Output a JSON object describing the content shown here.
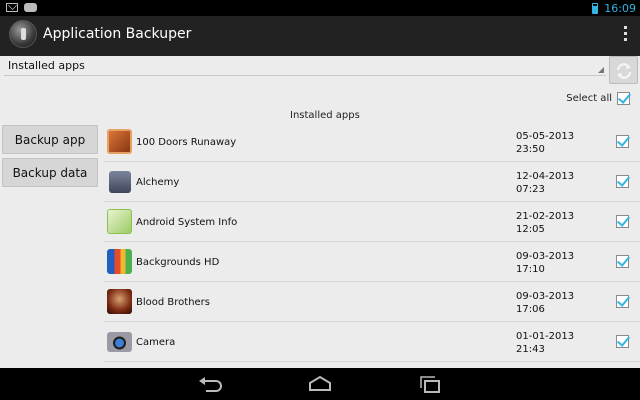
{
  "status_bar": {
    "time": "16:09"
  },
  "action_bar": {
    "title": "Application Backuper"
  },
  "spinner": {
    "selected": "Installed apps"
  },
  "select_all": {
    "label": "Select all"
  },
  "list_title": "Installed apps",
  "buttons": {
    "backup_app": "Backup app",
    "backup_data": "Backup data"
  },
  "apps": [
    {
      "name": "100 Doors Runaway",
      "date": "05-05-2013",
      "time": "23:50",
      "icon": "doors-app-icon",
      "color": "#b8541f"
    },
    {
      "name": "Alchemy",
      "date": "12-04-2013",
      "time": "07:23",
      "icon": "alchemy-app-icon",
      "color": "#5a6178"
    },
    {
      "name": "Android System Info",
      "date": "21-02-2013",
      "time": "12:05",
      "icon": "android-system-info-icon",
      "color": "#8bc34a"
    },
    {
      "name": "Backgrounds HD",
      "date": "09-03-2013",
      "time": "17:10",
      "icon": "backgrounds-hd-icon",
      "color": "#2a7fd4"
    },
    {
      "name": "Blood Brothers",
      "date": "09-03-2013",
      "time": "17:06",
      "icon": "blood-brothers-icon",
      "color": "#7a2a12"
    },
    {
      "name": "Camera",
      "date": "01-01-2013",
      "time": "21:43",
      "icon": "camera-app-icon",
      "color": "#4a4a55"
    }
  ],
  "colors": {
    "accent": "#33b5e5",
    "actionbar": "#222222"
  }
}
